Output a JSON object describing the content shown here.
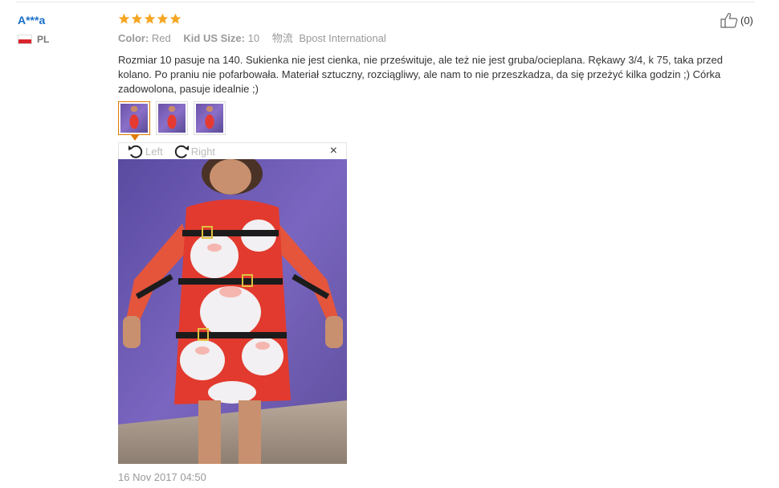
{
  "reviewer": {
    "name": "A***a",
    "country": "PL",
    "flag_colors": [
      "#ffffff",
      "#d9262c"
    ]
  },
  "rating": {
    "stars": 5,
    "max": 5,
    "color": "#f5a623"
  },
  "attributes": {
    "color_label": "Color:",
    "color_value": "Red",
    "size_label": "Kid US Size:",
    "size_value": "10",
    "shipping_label": "物流",
    "shipping_value": "Bpost International"
  },
  "review_text": "Rozmiar 10 pasuje na 140. Sukienka nie jest cienka, nie prześwituje, ale też nie jest gruba/ocieplana. Rękawy 3/4, k 75, taka przed kolano. Po praniu nie pofarbowała. Materiał sztuczny, rozciągliwy, ale nam to nie przeszkadza, da się przeżyć kilka godzin ;) Córka zadowolona, pasuje idealnie ;)",
  "helpful": {
    "icon": "thumbs-up-icon",
    "count": "(0)"
  },
  "thumbnails": [
    {
      "label": "photo-1",
      "active": true
    },
    {
      "label": "photo-2",
      "active": false
    },
    {
      "label": "photo-3",
      "active": false
    }
  ],
  "viewer": {
    "rotate_left_label": "Left",
    "rotate_right_label": "Right",
    "close_glyph": "×"
  },
  "date": "16 Nov 2017 04:50",
  "colors": {
    "accent": "#e07b00",
    "link": "#1a6fc9",
    "muted": "#999999"
  }
}
